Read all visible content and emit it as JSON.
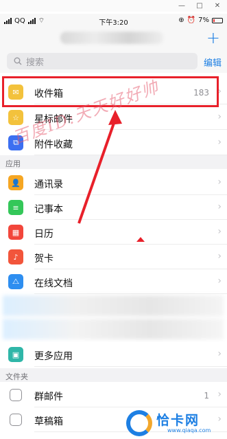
{
  "window_controls": {
    "minimize": "—",
    "maximize": "□",
    "close": "✕"
  },
  "status_bar": {
    "carrier": "QQ",
    "time": "下午3:20",
    "battery": "7%"
  },
  "header": {
    "plus": "+"
  },
  "search": {
    "placeholder": "搜索",
    "edit": "编辑"
  },
  "main_items": [
    {
      "label": "收件箱",
      "count": "183",
      "icon": "inbox-icon",
      "color": "#f3c23c",
      "glyph": "✉"
    },
    {
      "label": "星标邮件",
      "count": "",
      "icon": "star-icon",
      "color": "#f3c23c",
      "glyph": "☆"
    },
    {
      "label": "附件收藏",
      "count": "",
      "icon": "attachment-icon",
      "color": "#3c6ff1",
      "glyph": "⧉"
    }
  ],
  "sections": {
    "apps": "应用",
    "folders": "文件夹"
  },
  "app_items": [
    {
      "label": "通讯录",
      "icon": "contacts-icon",
      "color": "#f5a623",
      "glyph": "👤"
    },
    {
      "label": "记事本",
      "icon": "notes-icon",
      "color": "#34c759",
      "glyph": "≡"
    },
    {
      "label": "日历",
      "icon": "calendar-icon",
      "color": "#f2463b",
      "glyph": "▦"
    },
    {
      "label": "贺卡",
      "icon": "card-icon",
      "color": "#f2553b",
      "glyph": "♪"
    },
    {
      "label": "在线文档",
      "icon": "doc-icon",
      "color": "#2e8ef0",
      "glyph": "⧍"
    }
  ],
  "more_apps": {
    "label": "更多应用",
    "icon": "grid-icon",
    "color": "#2fb6a8",
    "glyph": "▣"
  },
  "folder_items": [
    {
      "label": "群邮件",
      "count": "1",
      "icon": "folder-icon"
    },
    {
      "label": "草稿箱",
      "count": "",
      "icon": "draft-icon"
    }
  ],
  "watermark": "百度ID:天天好好帅",
  "brand": {
    "name": "恰卡网",
    "url": "www.qiaqa.com"
  },
  "colors": {
    "accent": "#1d7fe3",
    "highlight": "#e8202a"
  }
}
